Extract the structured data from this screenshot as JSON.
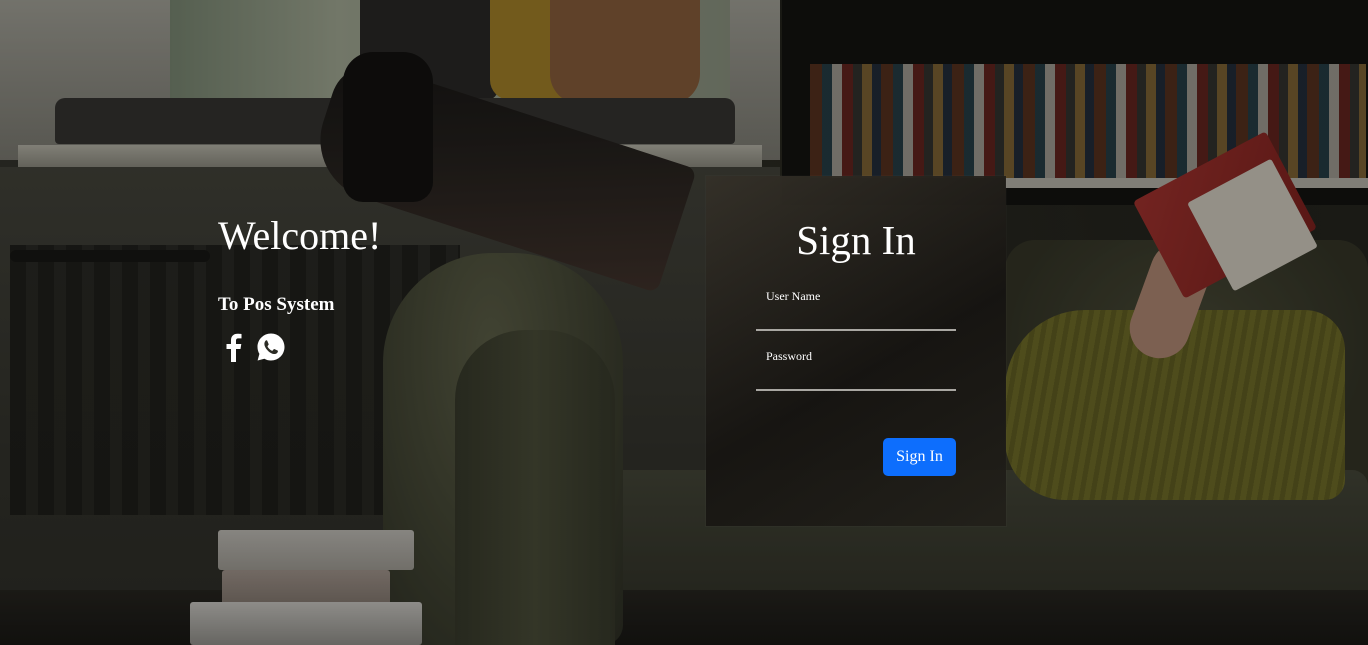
{
  "welcome": {
    "title": "Welcome!",
    "subtitle": "To Pos System",
    "social_icons": [
      "facebook-icon",
      "whatsapp-icon"
    ]
  },
  "signin": {
    "title": "Sign In",
    "username_label": "User Name",
    "username_value": "",
    "password_label": "Password",
    "password_value": "",
    "button_label": "Sign In"
  },
  "colors": {
    "button": "#0d6efd",
    "text": "#ffffff",
    "panel": "#1f1d19"
  }
}
